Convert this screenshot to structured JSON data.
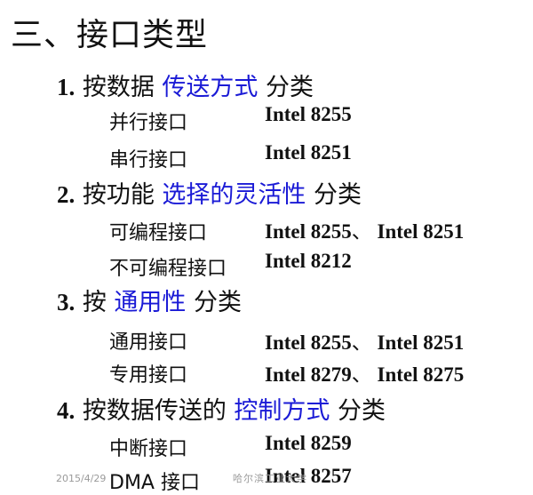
{
  "title": "三、接口类型",
  "sections": [
    {
      "num": "1.",
      "before": " 按数据 ",
      "highlight": "传送方式",
      "after": " 分类",
      "items": [
        {
          "name": "并行接口",
          "chips": "Intel 8255"
        },
        {
          "name": "串行接口",
          "chips": "Intel 8251"
        }
      ]
    },
    {
      "num": "2.",
      "before": " 按功能 ",
      "highlight": "选择的灵活性",
      "after": " 分类",
      "items": [
        {
          "name": "可编程接口",
          "chip1": "Intel 8255",
          "sep": "、",
          "chip2": " Intel 8251"
        },
        {
          "name": "不可编程接口",
          "chips": "Intel 8212"
        }
      ]
    },
    {
      "num": "3.",
      "before": " 按 ",
      "highlight": "通用性",
      "after": " 分类",
      "items": [
        {
          "name": "通用接口",
          "chip1": "Intel 8255",
          "sep": "、",
          "chip2": " Intel 8251"
        },
        {
          "name": "专用接口",
          "chip1": "Intel 8279",
          "sep": "、",
          "chip2": " Intel 8275"
        }
      ]
    },
    {
      "num": "4.",
      "before": " 按数据传送的 ",
      "highlight": "控制方式",
      "after": " 分类",
      "items": [
        {
          "name": "中断接口",
          "chips": "Intel 8259"
        },
        {
          "name": "DMA 接口",
          "chips": "Intel 8257"
        }
      ]
    }
  ],
  "footer": {
    "date": "2015/4/29",
    "school": "哈尔滨工业大学"
  },
  "colors": {
    "highlight": "#1a1ad6",
    "text": "#111111",
    "footer": "#9a9a9a"
  }
}
